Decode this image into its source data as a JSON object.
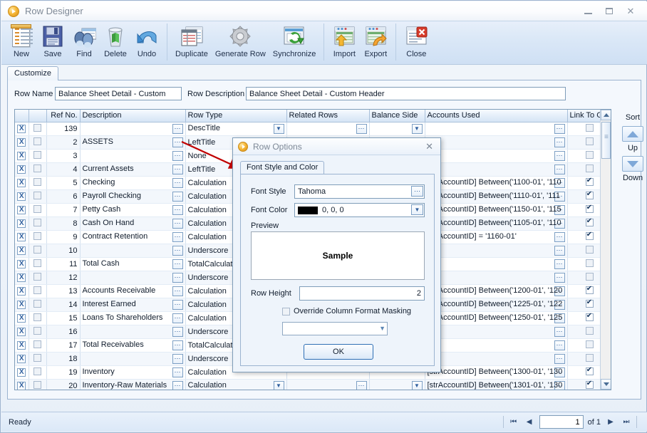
{
  "window": {
    "title": "Row Designer",
    "icon": "play-circle-icon",
    "minimize_label": "Minimize",
    "maximize_label": "Maximize",
    "close_label": "Close"
  },
  "toolbar": {
    "items": [
      {
        "label": "New",
        "icon": "new-document-icon"
      },
      {
        "label": "Save",
        "icon": "floppy-disk-icon"
      },
      {
        "label": "Find",
        "icon": "binoculars-icon"
      },
      {
        "label": "Delete",
        "icon": "recycle-bin-icon"
      },
      {
        "label": "Undo",
        "icon": "undo-arrow-icon"
      },
      {
        "label": "Duplicate",
        "icon": "duplicate-grid-icon"
      },
      {
        "label": "Generate Row",
        "icon": "gear-icon"
      },
      {
        "label": "Synchronize",
        "icon": "sync-arrow-icon"
      },
      {
        "label": "Import",
        "icon": "import-grid-icon"
      },
      {
        "label": "Export",
        "icon": "export-grid-icon"
      },
      {
        "label": "Close",
        "icon": "close-grid-icon"
      }
    ]
  },
  "tabs": [
    {
      "label": "Customize",
      "active": true
    }
  ],
  "form": {
    "row_name_label": "Row Name",
    "row_name_value": "Balance Sheet Detail - Custom",
    "row_description_label": "Row Description",
    "row_description_value": "Balance Sheet Detail - Custom Header"
  },
  "grid": {
    "columns": [
      "",
      "",
      "Ref No.",
      "Description",
      "Row Type",
      "Related Rows",
      "Balance Side",
      "Accounts Used",
      "Link To GL"
    ],
    "rows": [
      {
        "ref": "139",
        "desc": "",
        "type": "DescTitle",
        "accounts": "",
        "link": false
      },
      {
        "ref": "2",
        "desc": "ASSETS",
        "type": "LeftTitle",
        "accounts": "",
        "link": false
      },
      {
        "ref": "3",
        "desc": "",
        "type": "None",
        "accounts": "",
        "link": false
      },
      {
        "ref": "4",
        "desc": "Current Assets",
        "type": "LeftTitle",
        "accounts": "",
        "link": false
      },
      {
        "ref": "5",
        "desc": "Checking",
        "type": "Calculation",
        "accounts": "[strAccountID] Between('1100-01', '110",
        "link": true
      },
      {
        "ref": "6",
        "desc": "Payroll Checking",
        "type": "Calculation",
        "accounts": "[strAccountID] Between('1110-01', '111",
        "link": true
      },
      {
        "ref": "7",
        "desc": "Petty Cash",
        "type": "Calculation",
        "accounts": "[strAccountID] Between('1150-01', '115",
        "link": true
      },
      {
        "ref": "8",
        "desc": "Cash On Hand",
        "type": "Calculation",
        "accounts": "[strAccountID] Between('1105-01', '110",
        "link": true
      },
      {
        "ref": "9",
        "desc": "Contract Retention",
        "type": "Calculation",
        "accounts": "[strAccountID] = '1160-01'",
        "link": true
      },
      {
        "ref": "10",
        "desc": "",
        "type": "Underscore",
        "accounts": "",
        "link": false
      },
      {
        "ref": "11",
        "desc": "Total Cash",
        "type": "TotalCalculation",
        "accounts": "",
        "link": false
      },
      {
        "ref": "12",
        "desc": "",
        "type": "Underscore",
        "accounts": "",
        "link": false
      },
      {
        "ref": "13",
        "desc": "Accounts Receivable",
        "type": "Calculation",
        "accounts": "[strAccountID] Between('1200-01', '120",
        "link": true
      },
      {
        "ref": "14",
        "desc": "Interest Earned",
        "type": "Calculation",
        "accounts": "[strAccountID] Between('1225-01', '122",
        "link": true
      },
      {
        "ref": "15",
        "desc": "Loans To Shareholders",
        "type": "Calculation",
        "accounts": "[strAccountID] Between('1250-01', '125",
        "link": true
      },
      {
        "ref": "16",
        "desc": "",
        "type": "Underscore",
        "accounts": "",
        "link": false
      },
      {
        "ref": "17",
        "desc": "Total Receivables",
        "type": "TotalCalculation",
        "accounts": "",
        "link": false
      },
      {
        "ref": "18",
        "desc": "",
        "type": "Underscore",
        "accounts": "",
        "link": false
      },
      {
        "ref": "19",
        "desc": "Inventory",
        "type": "Calculation",
        "accounts": "[strAccountID] Between('1300-01', '130",
        "link": true
      },
      {
        "ref": "20",
        "desc": "Inventory-Raw Materials",
        "type": "Calculation",
        "accounts": "[strAccountID] Between('1301-01', '130",
        "link": true
      }
    ],
    "delete_row_label": "X",
    "ellipsis_label": "⋯"
  },
  "sort": {
    "title": "Sort",
    "up_label": "Up",
    "down_label": "Down"
  },
  "dialog": {
    "title": "Row Options",
    "icon": "play-circle-icon",
    "close_label": "✕",
    "tab_label": "Font Style and Color",
    "font_style_label": "Font Style",
    "font_style_value": "Tahoma",
    "font_color_label": "Font Color",
    "font_color_value": "0, 0, 0",
    "font_color_hex": "#000000",
    "preview_label": "Preview",
    "preview_sample_text": "Sample",
    "row_height_label": "Row Height",
    "row_height_value": "2",
    "override_label": "Override Column Format Masking",
    "override_checked": false,
    "mask_value": "",
    "ok_label": "OK"
  },
  "statusbar": {
    "status": "Ready",
    "first_label": "⏮",
    "prev_label": "◀",
    "page_value": "1",
    "of_label": "of 1",
    "next_label": "▶",
    "last_label": "⏭"
  },
  "annotation": {
    "arrow_color": "#c00000",
    "description": "red-arrow-pointing-to-dialog"
  }
}
